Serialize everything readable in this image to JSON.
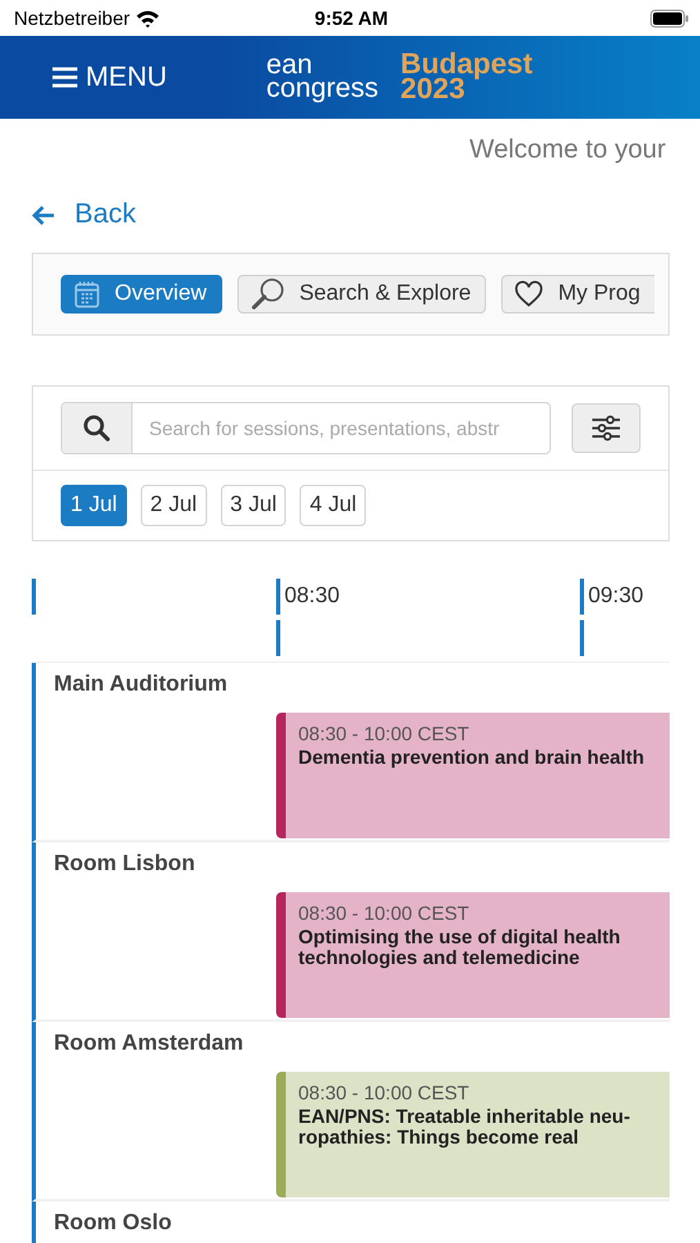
{
  "status_bar": {
    "carrier": "Netzbetreiber",
    "time": "9:52 AM"
  },
  "header": {
    "menu": "MENU",
    "logo_line_1": "ean",
    "logo_line_2": "congress",
    "logo_city": "Budapest",
    "logo_year": "2023"
  },
  "welcome": "Welcome to your",
  "back": "Back",
  "tabs": [
    {
      "label": "Overview",
      "kind": "calendar",
      "selected": true
    },
    {
      "label": "Search & Explore",
      "kind": "search",
      "selected": false
    },
    {
      "label": "My Prog",
      "kind": "heart",
      "selected": false
    }
  ],
  "search": {
    "placeholder": "Search for sessions, presentations, abstr"
  },
  "dates": [
    {
      "label": "1 Jul",
      "selected": true
    },
    {
      "label": "2 Jul",
      "selected": false
    },
    {
      "label": "3 Jul",
      "selected": false
    },
    {
      "label": "4 Jul",
      "selected": false
    }
  ],
  "timeline": {
    "times": [
      "08:30",
      "09:30"
    ],
    "rooms": [
      {
        "name": "Main Auditorium",
        "sessions": [
          {
            "time": "08:30 - 10:00 CEST",
            "title": "Dementia prevention and brain health",
            "color": "#b5265e"
          }
        ]
      },
      {
        "name": "Room Lisbon",
        "sessions": [
          {
            "time": "08:30 - 10:00 CEST",
            "title": "Optimising the use of digital health technologies and telemedicine",
            "color": "#b5265e"
          }
        ]
      },
      {
        "name": "Room Amsterdam",
        "sessions": [
          {
            "time": "08:30 - 10:00 CEST",
            "title": "EAN/PNS: Treatable inheritable neu-ropathies: Things become real",
            "color": "#9aab5a"
          }
        ]
      },
      {
        "name": "Room Oslo"
      }
    ]
  }
}
